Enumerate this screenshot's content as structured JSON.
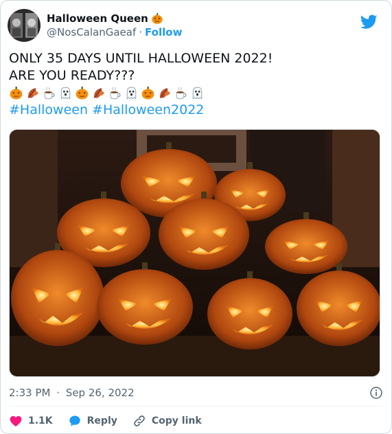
{
  "author": {
    "display_name": "Halloween Queen",
    "handle": "@NosCalanGaeaf",
    "separator": "·",
    "follow_label": "Follow"
  },
  "tweet": {
    "line1": "ONLY 35 DAYS UNTIL HALLOWEEN 2022!",
    "line2": "ARE YOU READY???",
    "emoji_sequence": [
      "jack-o-lantern",
      "fallen-leaf",
      "hot-beverage",
      "ghost",
      "jack-o-lantern",
      "fallen-leaf",
      "hot-beverage",
      "ghost",
      "jack-o-lantern",
      "fallen-leaf",
      "hot-beverage",
      "ghost"
    ],
    "hashtags": [
      "#Halloween",
      "#Halloween2022"
    ]
  },
  "timestamp": {
    "time": "2:33 PM",
    "separator": "·",
    "date": "Sep 26, 2022"
  },
  "actions": {
    "likes": "1.1K",
    "reply_label": "Reply",
    "copy_link_label": "Copy link"
  },
  "colors": {
    "accent": "#1d9bf0",
    "like": "#f91880",
    "secondary_text": "#536471"
  }
}
